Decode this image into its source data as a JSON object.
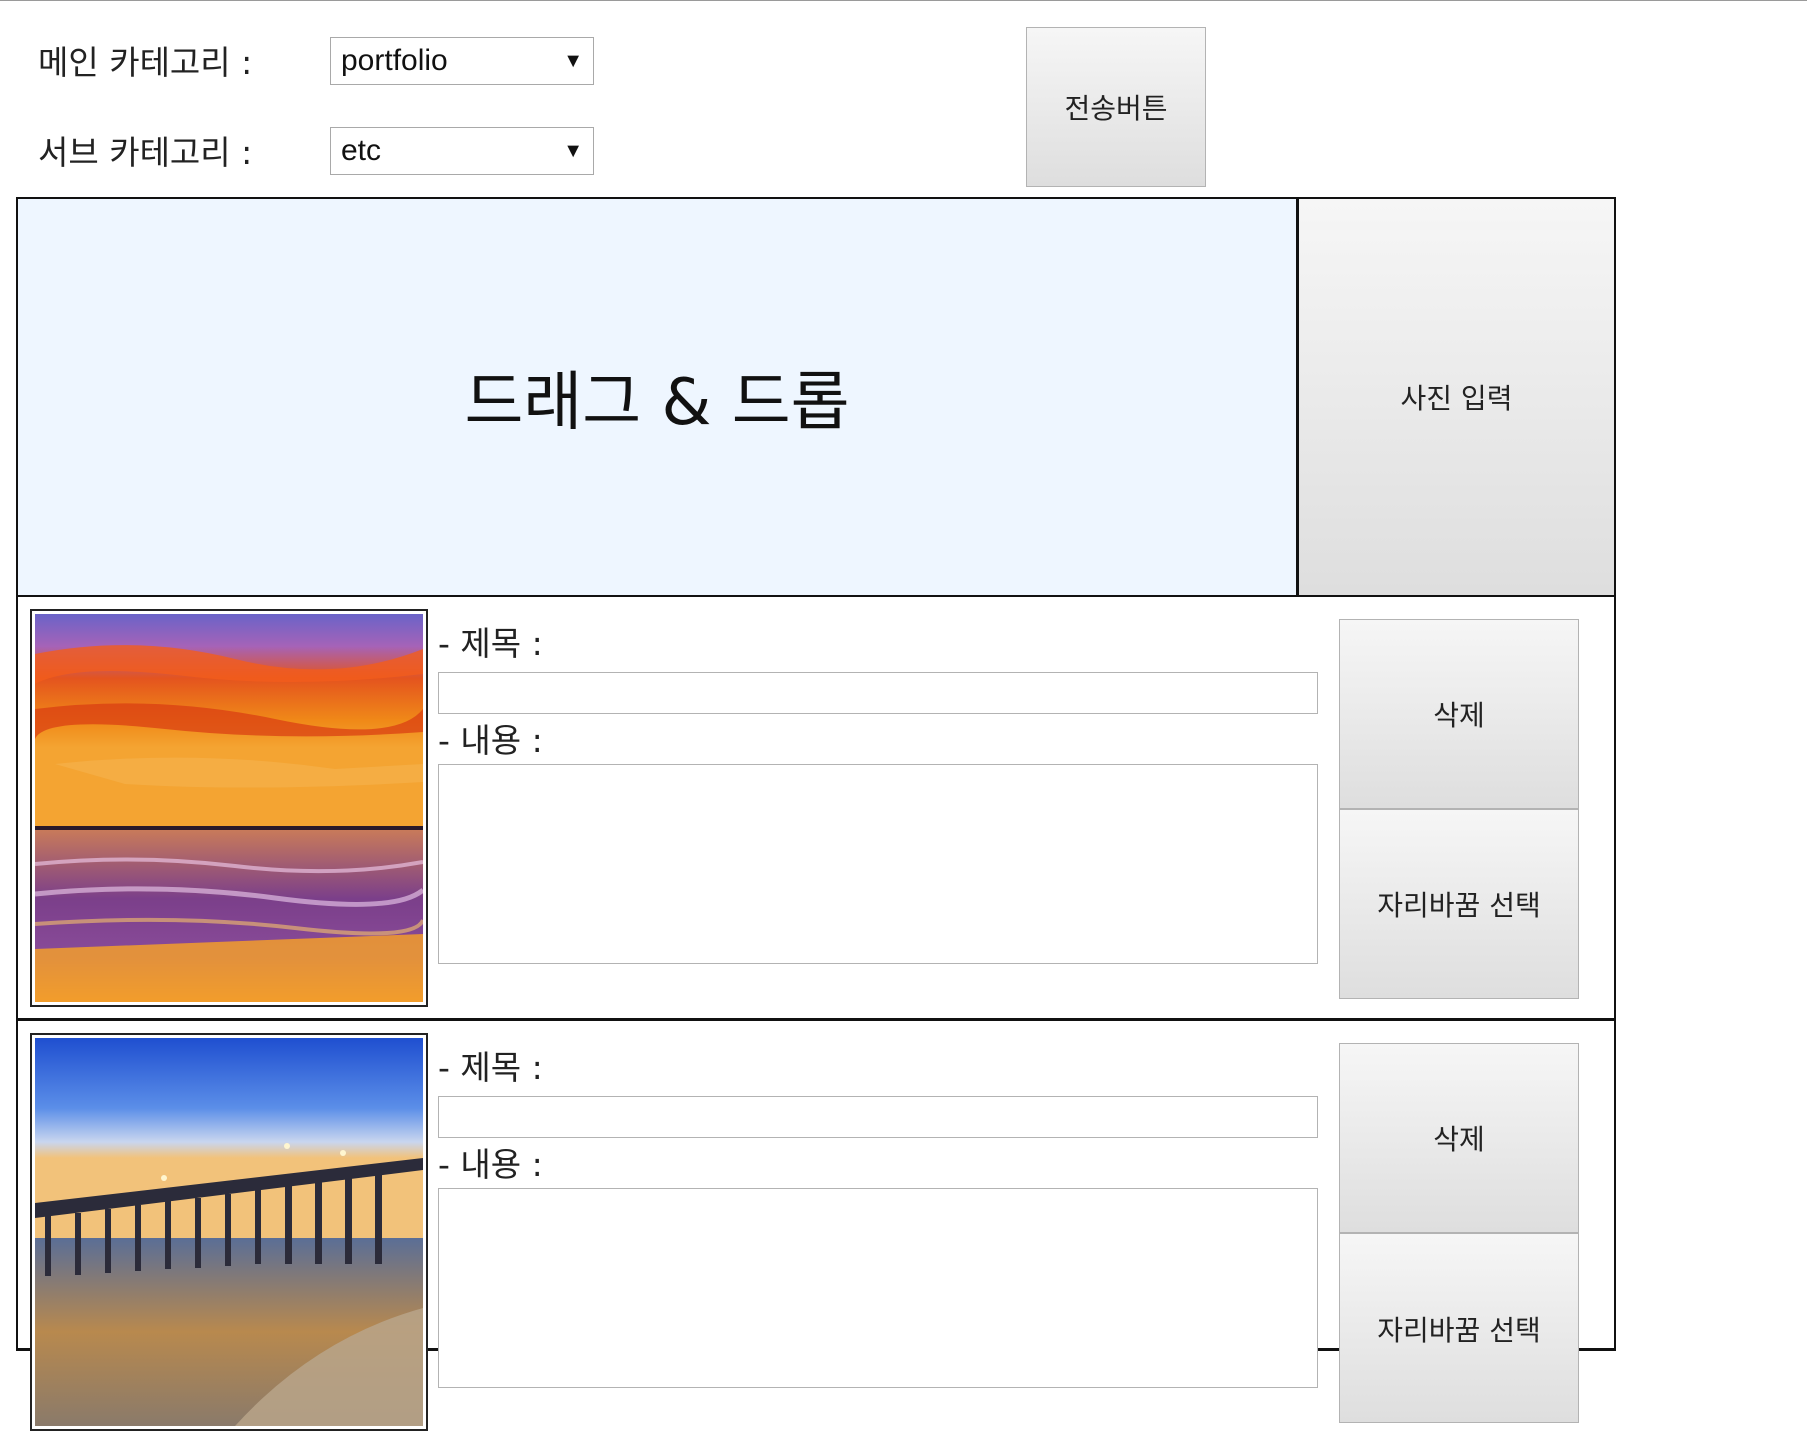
{
  "form": {
    "main_category_label": "메인 카테고리 :",
    "main_category_value": "portfolio",
    "sub_category_label": "서브 카테고리 :",
    "sub_category_value": "etc",
    "submit_label": "전송버튼"
  },
  "upload": {
    "dropzone_text": "드래그 & 드롭",
    "photo_input_label": "사진 입력"
  },
  "entries": [
    {
      "title_label": "- 제목 :",
      "title_value": "",
      "content_label": "- 내용 :",
      "content_value": "",
      "delete_label": "삭제",
      "swap_label": "자리바꿈 선택"
    },
    {
      "title_label": "- 제목 :",
      "title_value": "",
      "content_label": "- 내용 :",
      "content_value": "",
      "delete_label": "삭제",
      "swap_label": "자리바꿈 선택"
    }
  ],
  "icons": {
    "dropdown": "chevron-down-icon"
  }
}
